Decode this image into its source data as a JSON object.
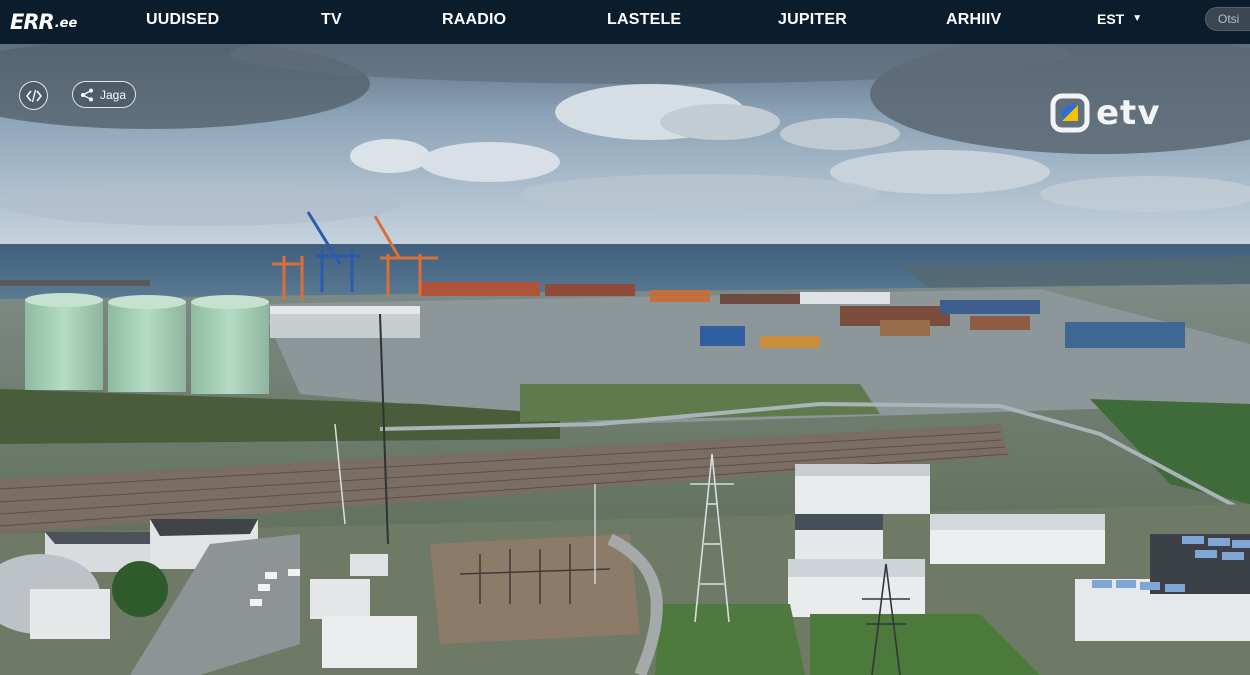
{
  "header": {
    "logo_main": "ERR",
    "logo_tld": ".ee",
    "nav": [
      {
        "label": "UUDISED"
      },
      {
        "label": "TV"
      },
      {
        "label": "RAADIO"
      },
      {
        "label": "LASTELE"
      },
      {
        "label": "JUPITER"
      },
      {
        "label": "ARHIIV"
      }
    ],
    "language": "EST",
    "search_placeholder": "Otsi"
  },
  "player": {
    "share_label": "Jaga",
    "channel_logo_text": "etv"
  },
  "colors": {
    "nav_background": "#0b1c2d",
    "sea": "#4a6a86",
    "tanks": "#a8d0b8",
    "crane_blue": "#2b5bb0",
    "crane_orange": "#d9703a"
  }
}
